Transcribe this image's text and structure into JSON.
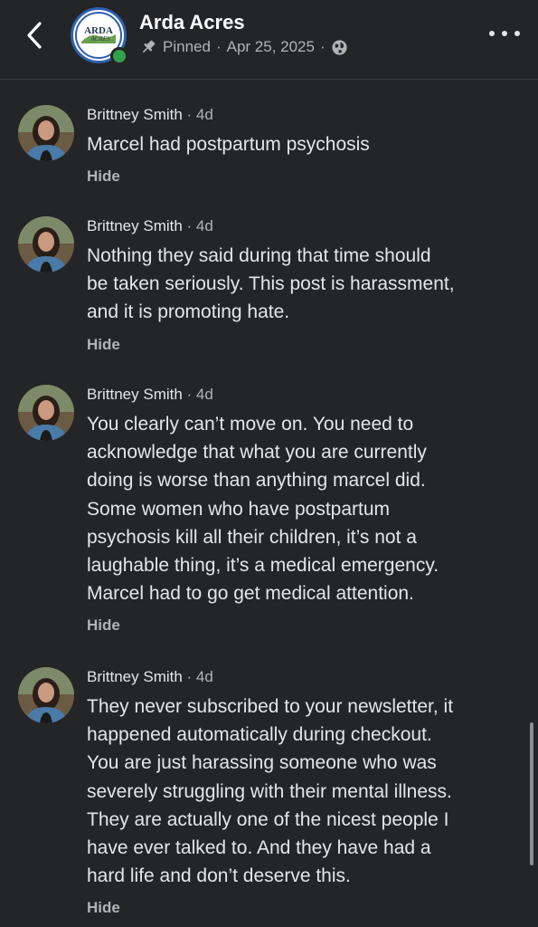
{
  "header": {
    "title": "Arda Acres",
    "pinned_label": "Pinned",
    "date": "Apr 25, 2025",
    "separator": "·",
    "logo_text": "ARDA ACRES"
  },
  "comments": [
    {
      "author": "Brittney Smith",
      "time": "· 4d",
      "text": "Marcel had postpartum psychosis",
      "action": "Hide"
    },
    {
      "author": "Brittney Smith",
      "time": "· 4d",
      "text": "Nothing they said during that time should\nbe taken seriously. This post is harassment,\nand it is promoting hate.",
      "action": "Hide"
    },
    {
      "author": "Brittney Smith",
      "time": "· 4d",
      "text": "You clearly can’t move on. You need to\nacknowledge that what you are currently\ndoing is worse than anything marcel did.\nSome women who have postpartum\npsychosis kill all their children, it’s not a\nlaughable thing, it’s a medical emergency.\nMarcel had to go get medical attention.",
      "action": "Hide"
    },
    {
      "author": "Brittney Smith",
      "time": "· 4d",
      "text": "They never subscribed to your newsletter, it\nhappened automatically during checkout.\nYou are just harassing someone who was\nseverely struggling with their mental illness.\nThey are actually one of the nicest people I\nhave ever talked to. And they have had a\nhard life and don’t deserve this.",
      "action": "Hide"
    }
  ],
  "colors": {
    "background": "#242527",
    "text": "#e4e6eb",
    "secondary": "#b0b3b8",
    "online": "#31a24c"
  }
}
